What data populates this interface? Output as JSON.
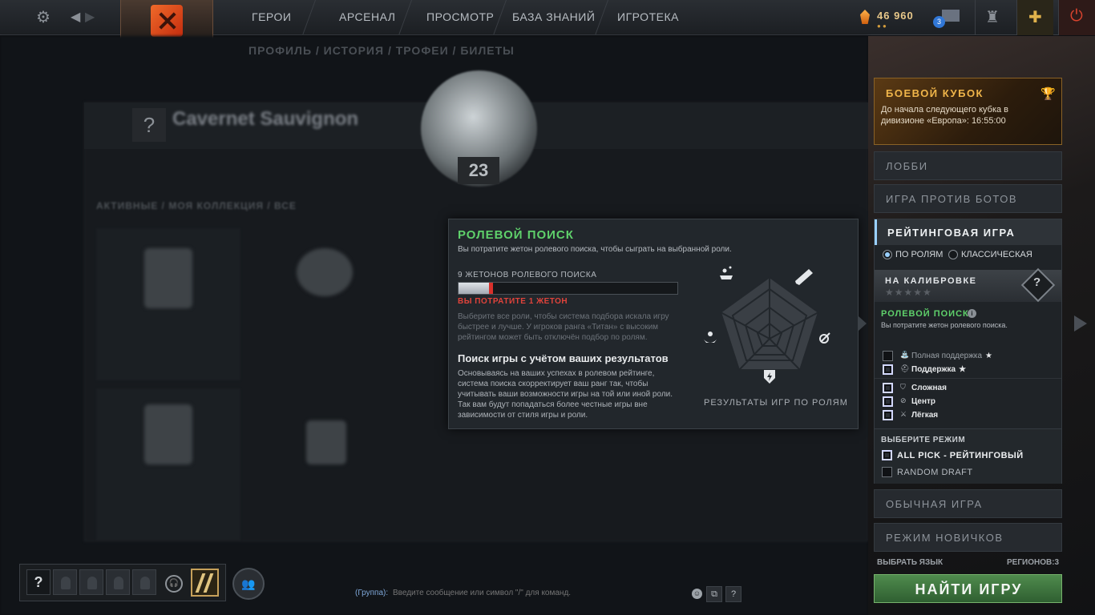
{
  "topbar": {
    "nav": [
      "ГЕРОИ",
      "АРСЕНАЛ",
      "ПРОСМОТР",
      "БАЗА ЗНАНИЙ",
      "ИГРОТЕКА"
    ],
    "currency": "46 960",
    "mail_count": "3",
    "icons": [
      "gear-icon",
      "back-arrow-icon",
      "forward-arrow-icon",
      "dota-logo-icon",
      "shard-icon",
      "mail-icon",
      "armory-icon",
      "plus-icon",
      "power-icon"
    ]
  },
  "profile": {
    "tabs": "ПРОФИЛЬ  /  ИСТОРИЯ  /  ТРОФЕИ  /  БИЛЕТЫ",
    "name": "Cavernet Sauvignon",
    "level": "23",
    "filter": "АКТИВНЫЕ  /  МОЯ КОЛЛЕКЦИЯ  /  ВСЕ"
  },
  "popup": {
    "title": "РОЛЕВОЙ ПОИСК",
    "subtitle": "Вы потратите жетон ролевого поиска, чтобы сыграть на выбранной роли.",
    "tokens_label": "9 ЖЕТОНОВ РОЛЕВОГО ПОИСКА",
    "token_fill": 0.14,
    "spend_warning": "ВЫ ПОТРАТИТЕ 1 ЖЕТОН",
    "note": "Выберите все роли, чтобы система подбора искала игру быстрее и лучше. У игроков ранга «Титан» с высоким рейтингом может быть отключён подбор по ролям.",
    "heading": "Поиск игры с учётом ваших результатов",
    "body": "Основываясь на ваших успехах в ролевом рейтинге, система поиска скорректирует ваш ранг так, чтобы учитывать ваши возможности игры на той или иной роли. Так вам будут попадаться более честные игры вне зависимости от стиля игры и роли.",
    "radar_label": "РЕЗУЛЬТАТЫ ИГР ПО РОЛЯМ"
  },
  "battle_cup": {
    "title": "БОЕВОЙ КУБОК",
    "text": "До начала следующего кубка в дивизионе «Европа»: 16:55:00"
  },
  "modes": {
    "lobby": "ЛОББИ",
    "bots": "ИГРА ПРОТИВ БОТОВ",
    "ranked": "РЕЙТИНГОВАЯ ИГРА",
    "unranked": "ОБЫЧНАЯ ИГРА",
    "newbie": "РЕЖИМ НОВИЧКОВ"
  },
  "ranked": {
    "radio_roles": "ПО РОЛЯМ",
    "radio_classic": "КЛАССИЧЕСКАЯ",
    "calibration_title": "НА КАЛИБРОВКЕ",
    "calibration_stars": "★★★★★",
    "role_search_title": "РОЛЕВОЙ ПОИСК",
    "role_search_sub": "Вы потратите жетон ролевого поиска.",
    "roles": [
      {
        "name": "Полная поддержка",
        "checked": false,
        "icon": "hard-support-icon",
        "star": "★"
      },
      {
        "name": "Поддержка",
        "checked": true,
        "icon": "soft-support-icon",
        "star": "★"
      },
      {
        "name": "Сложная",
        "checked": true,
        "icon": "offlane-icon",
        "star": ""
      },
      {
        "name": "Центр",
        "checked": true,
        "icon": "mid-icon",
        "star": ""
      },
      {
        "name": "Лёгкая",
        "checked": true,
        "icon": "safe-lane-icon",
        "star": ""
      }
    ],
    "mode_select_title": "ВЫБЕРИТЕ РЕЖИМ",
    "mode_options": [
      {
        "name": "ALL PICK - РЕЙТИНГОВЫЙ",
        "checked": true
      },
      {
        "name": "RANDOM DRAFT",
        "checked": false
      }
    ]
  },
  "footer": {
    "language": "ВЫБРАТЬ ЯЗЫК",
    "regions": "РЕГИОНОВ:3",
    "find_game": "НАЙТИ ИГРУ"
  },
  "chat": {
    "channel": "(Группа):",
    "placeholder": "Введите сообщение или символ \"/\" для команд."
  }
}
